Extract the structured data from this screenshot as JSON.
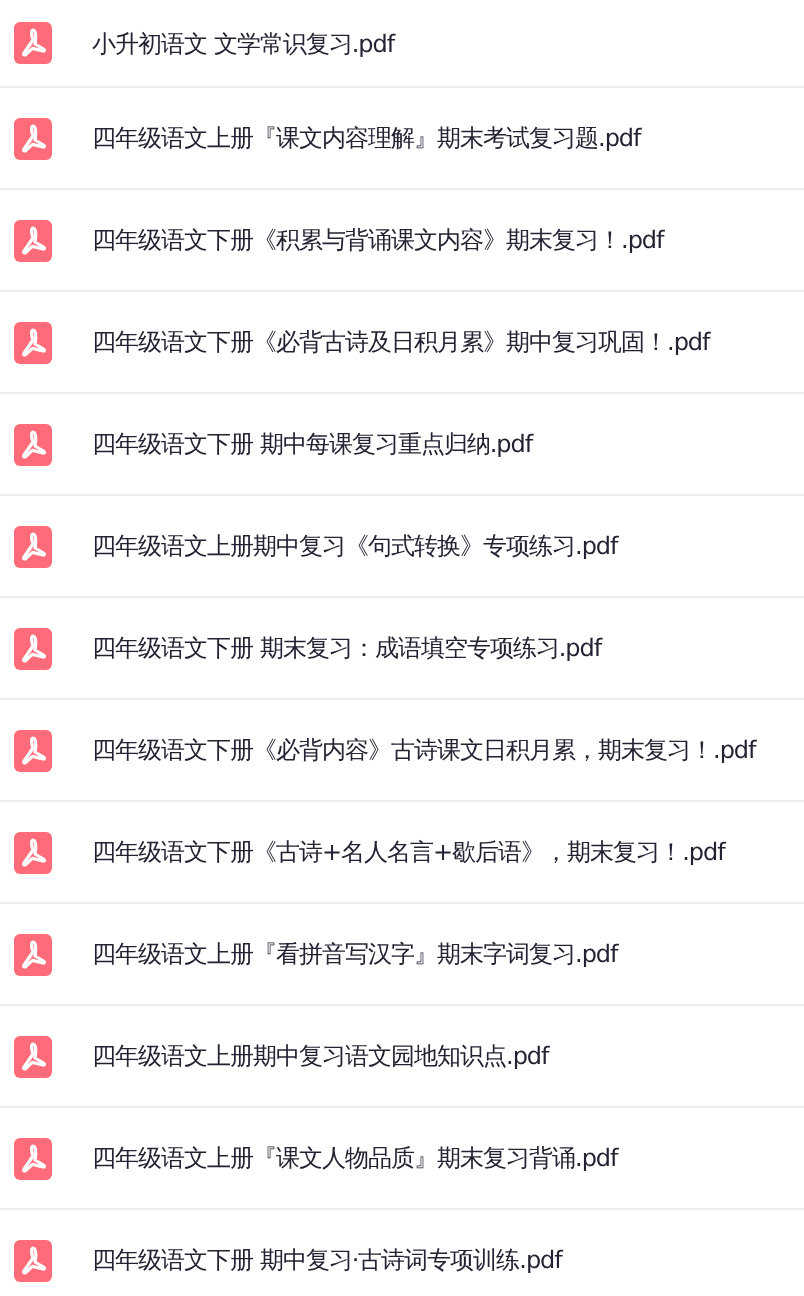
{
  "files": [
    {
      "name": "小升初语文 文学常识复习.pdf",
      "kind": "pdf"
    },
    {
      "name": "四年级语文上册『课文内容理解』期末考试复习题.pdf",
      "kind": "pdf"
    },
    {
      "name": "四年级语文下册《积累与背诵课文内容》期末复习！.pdf",
      "kind": "pdf"
    },
    {
      "name": "四年级语文下册《必背古诗及日积月累》期中复习巩固！.pdf",
      "kind": "pdf"
    },
    {
      "name": "四年级语文下册 期中每课复习重点归纳.pdf",
      "kind": "pdf"
    },
    {
      "name": "四年级语文上册期中复习《句式转换》专项练习.pdf",
      "kind": "pdf"
    },
    {
      "name": "四年级语文下册 期末复习：成语填空专项练习.pdf",
      "kind": "pdf"
    },
    {
      "name": "四年级语文下册《必背内容》古诗课文日积月累，期末复习！.pdf",
      "kind": "pdf"
    },
    {
      "name": "四年级语文下册《古诗+名人名言+歇后语》，期末复习！.pdf",
      "kind": "pdf"
    },
    {
      "name": "四年级语文上册『看拼音写汉字』期末字词复习.pdf",
      "kind": "pdf"
    },
    {
      "name": "四年级语文上册期中复习语文园地知识点.pdf",
      "kind": "pdf"
    },
    {
      "name": "四年级语文上册『课文人物品质』期末复习背诵.pdf",
      "kind": "pdf"
    },
    {
      "name": "四年级语文下册 期中复习·古诗词专项训练.pdf",
      "kind": "pdf"
    }
  ]
}
